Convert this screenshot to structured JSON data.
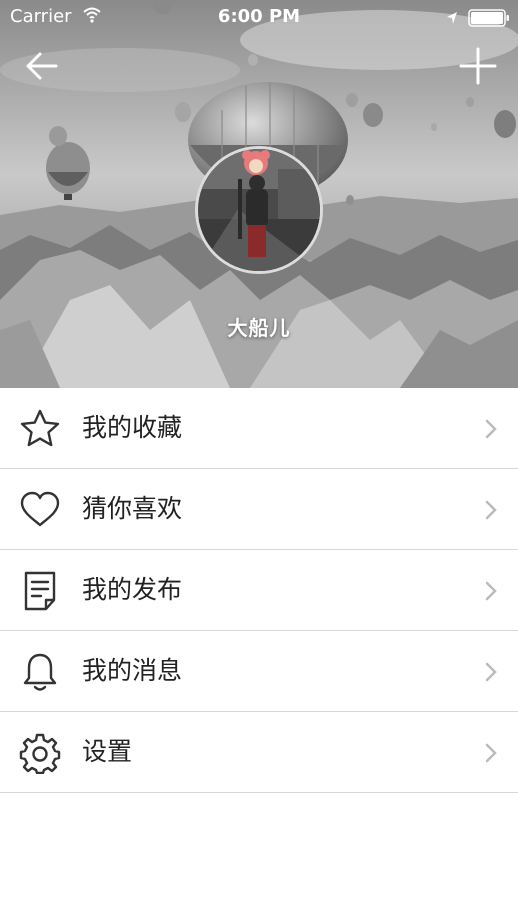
{
  "status_bar": {
    "carrier": "Carrier",
    "time": "6:00 PM",
    "wifi_icon": "wifi-icon",
    "location_icon": "location-arrow-icon",
    "battery_icon": "battery-icon"
  },
  "header": {
    "back_icon": "arrow-left-icon",
    "add_icon": "plus-icon",
    "username": "大船儿"
  },
  "menu": {
    "items": [
      {
        "label": "我的收藏",
        "icon": "star-icon"
      },
      {
        "label": "猜你喜欢",
        "icon": "heart-icon"
      },
      {
        "label": "我的发布",
        "icon": "document-icon"
      },
      {
        "label": "我的消息",
        "icon": "bell-icon"
      },
      {
        "label": "设置",
        "icon": "gear-icon"
      }
    ],
    "chevron_icon": "chevron-right-icon"
  },
  "colors": {
    "text": "#222222",
    "divider": "#d8d8d8",
    "chevron": "#bbbbbb",
    "icon": "#333333"
  }
}
